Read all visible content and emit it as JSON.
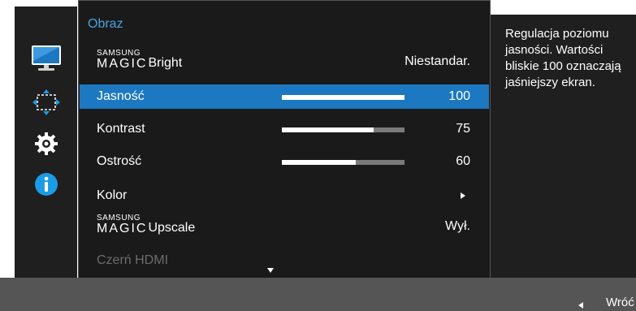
{
  "menu": {
    "title": "Obraz",
    "items": [
      {
        "id": "magic-bright",
        "brand_sup": "SAMSUNG",
        "brand_big": "MAGIC",
        "label": "Bright",
        "value": "Niestandar."
      },
      {
        "id": "brightness",
        "label": "Jasność",
        "value": "100",
        "level": 100,
        "selected": true
      },
      {
        "id": "contrast",
        "label": "Kontrast",
        "value": "75",
        "level": 75
      },
      {
        "id": "sharpness",
        "label": "Ostrość",
        "value": "60",
        "level": 60
      },
      {
        "id": "color",
        "label": "Kolor",
        "value": ""
      },
      {
        "id": "magic-upscale",
        "brand_sup": "SAMSUNG",
        "brand_big": "MAGIC",
        "label": "Upscale",
        "value": "Wył."
      },
      {
        "id": "hdmi-black",
        "label": "Czerń HDMI",
        "value": "",
        "disabled": true
      }
    ]
  },
  "help": {
    "text": "Regulacja poziomu jasności. Wartości bliskie 100 oznaczają jaśniejszy ekran."
  },
  "bottom": {
    "back_label": "Wróć"
  },
  "side_icons": [
    "monitor-icon",
    "move-arrows-icon",
    "gear-icon",
    "info-icon"
  ],
  "colors": {
    "accent": "#1c78c0",
    "title": "#4aa3df",
    "panel": "#1a1a1a",
    "bottom_bar": "#555555"
  }
}
